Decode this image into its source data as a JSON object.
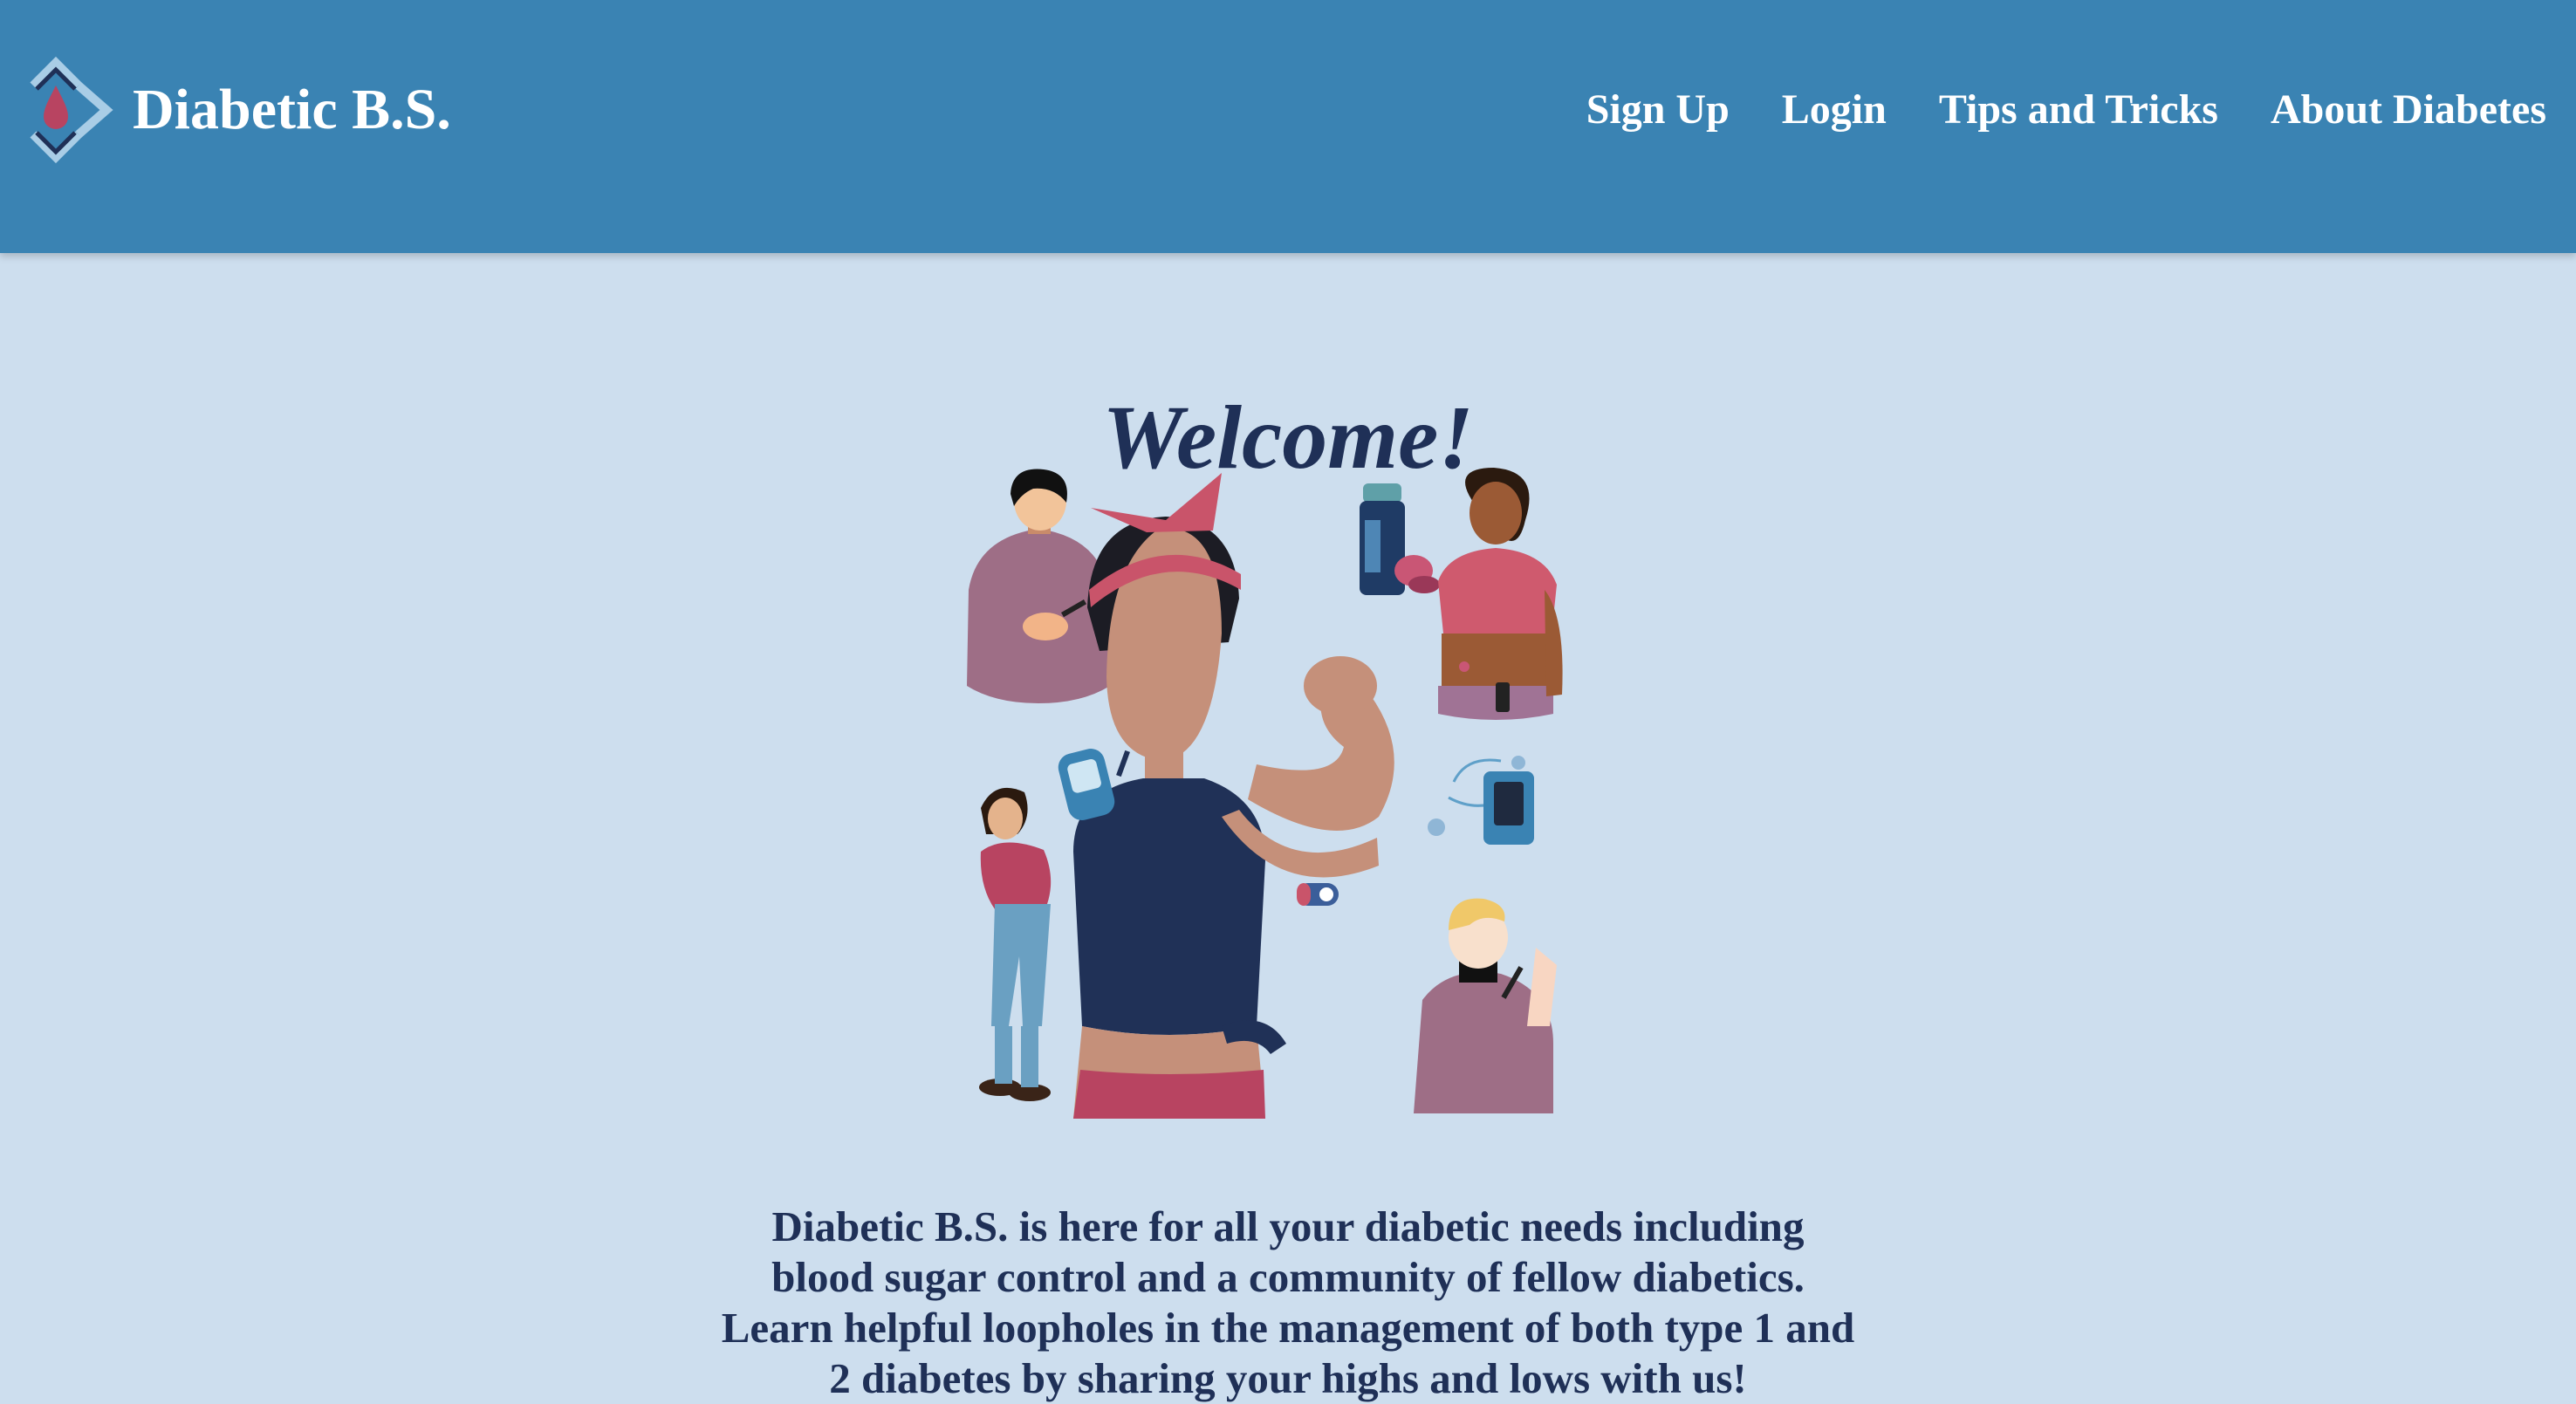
{
  "header": {
    "brand": "Diabetic B.S.",
    "nav": [
      {
        "label": "Sign Up"
      },
      {
        "label": "Login"
      },
      {
        "label": "Tips and Tricks"
      },
      {
        "label": "About Diabetes"
      }
    ]
  },
  "main": {
    "heading": "Welcome!",
    "hero_image": "diabetes-community-illustration",
    "intro": "Diabetic B.S. is here for all your diabetic needs including blood sugar control and a community of fellow diabetics. Learn helpful loopholes in the management of both type 1 and 2 diabetes by sharing your highs and lows with us!"
  },
  "colors": {
    "navbar": "#3a83b3",
    "background": "#cddeee",
    "heading": "#1f3057",
    "accent": "#c9546a"
  }
}
